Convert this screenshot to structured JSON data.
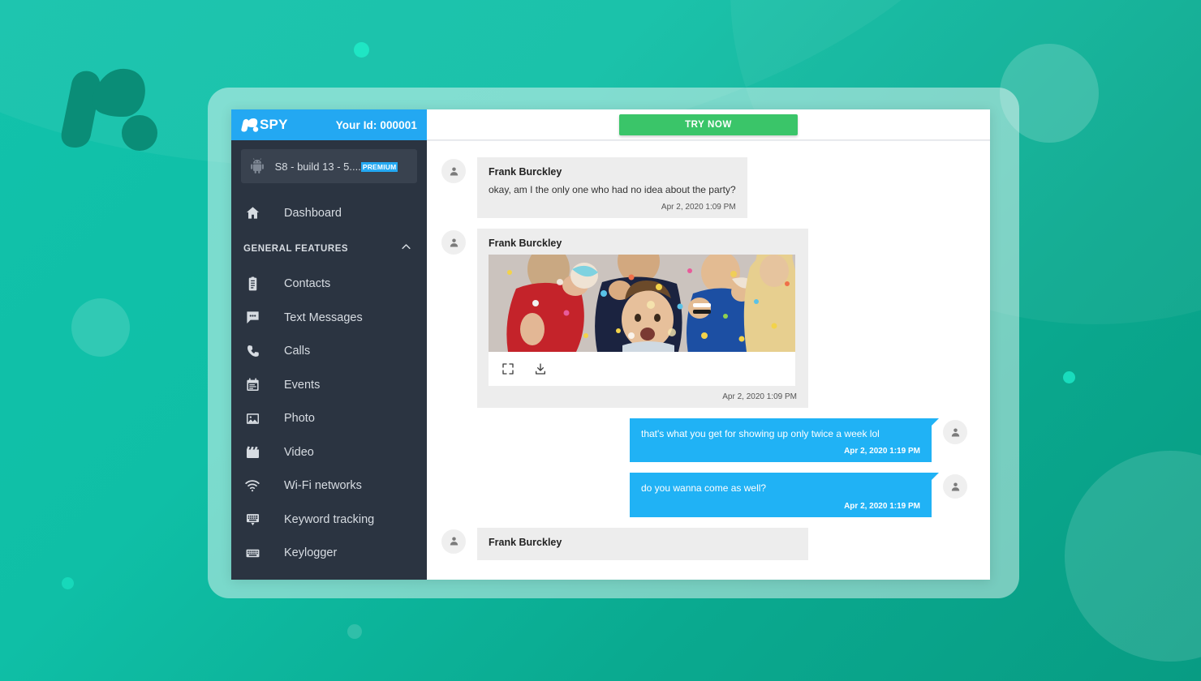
{
  "brand": {
    "logo_text": "SPY",
    "logo_icon": "mspy-m-logo",
    "user_id_label": "Your Id: 000001",
    "header_color": "#23a8f2"
  },
  "topbar": {
    "try_now_label": "TRY NOW",
    "try_now_color": "#3ac569"
  },
  "sidebar": {
    "background": "#2b3441",
    "device": {
      "icon": "android-icon",
      "name": "S8 - build 13 - 5....",
      "badge": "PREMIUM",
      "badge_color": "#23a8f2"
    },
    "dashboard": {
      "icon": "home-icon",
      "label": "Dashboard"
    },
    "section": {
      "label": "GENERAL FEATURES",
      "chevron": "chevron-up-icon"
    },
    "items": [
      {
        "icon": "contacts-icon",
        "label": "Contacts"
      },
      {
        "icon": "message-icon",
        "label": "Text Messages"
      },
      {
        "icon": "phone-icon",
        "label": "Calls"
      },
      {
        "icon": "calendar-icon",
        "label": "Events"
      },
      {
        "icon": "photo-icon",
        "label": "Photo"
      },
      {
        "icon": "video-icon",
        "label": "Video"
      },
      {
        "icon": "wifi-icon",
        "label": "Wi-Fi networks"
      },
      {
        "icon": "keyword-icon",
        "label": "Keyword tracking"
      },
      {
        "icon": "keyboard-icon",
        "label": "Keylogger"
      }
    ]
  },
  "chat": {
    "incoming_bubble_color": "#ededed",
    "outgoing_bubble_color": "#20b2f5",
    "image_actions": {
      "expand": "expand-icon",
      "download": "download-icon"
    },
    "messages": [
      {
        "direction": "in",
        "sender": "Frank Burckley",
        "text": "okay, am I the only one who had no idea about the party?",
        "time": "Apr 2, 2020 1:09 PM",
        "type": "text"
      },
      {
        "direction": "in",
        "sender": "Frank Burckley",
        "text": "",
        "time": "Apr 2, 2020 1:09 PM",
        "type": "image"
      },
      {
        "direction": "out",
        "sender": "",
        "text": "that's what you get for showing up only twice a week lol",
        "time": "Apr 2, 2020 1:19 PM",
        "type": "text"
      },
      {
        "direction": "out",
        "sender": "",
        "text": "do you wanna come as well?",
        "time": "Apr 2, 2020 1:19 PM",
        "type": "text"
      },
      {
        "direction": "in",
        "sender": "Frank Burckley",
        "text": "",
        "time": "",
        "type": "partial"
      }
    ]
  }
}
